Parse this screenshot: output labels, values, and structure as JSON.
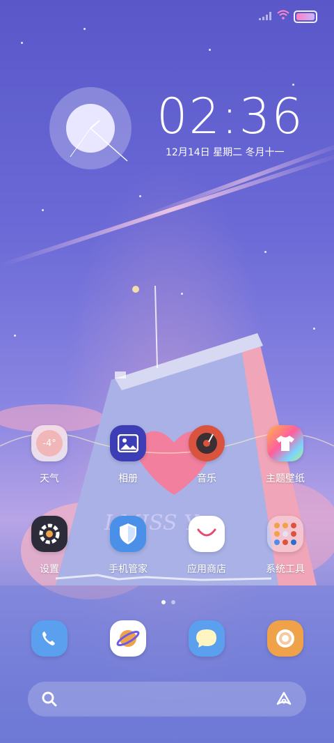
{
  "status_bar": {
    "signal_icon": "signal-icon",
    "wifi_icon": "wifi-icon",
    "battery_icon": "battery-icon"
  },
  "clock": {
    "time": "02:36",
    "date": "12月14日 星期二 冬月十一"
  },
  "wallpaper": {
    "illustration_text": "I MISS Y"
  },
  "apps": [
    {
      "label": "天气",
      "icon": "weather-icon",
      "value": "-4°"
    },
    {
      "label": "相册",
      "icon": "gallery-icon"
    },
    {
      "label": "音乐",
      "icon": "music-icon"
    },
    {
      "label": "主题壁纸",
      "icon": "theme-icon"
    },
    {
      "label": "设置",
      "icon": "settings-icon"
    },
    {
      "label": "手机管家",
      "icon": "shield-icon"
    },
    {
      "label": "应用商店",
      "icon": "app-store-icon"
    },
    {
      "label": "系统工具",
      "icon": "folder-icon"
    }
  ],
  "page_indicator": {
    "pages": 2,
    "active": 0
  },
  "dock": [
    {
      "icon": "phone-icon"
    },
    {
      "icon": "browser-icon"
    },
    {
      "icon": "messages-icon"
    },
    {
      "icon": "camera-icon"
    }
  ],
  "search_bar": {
    "search_icon": "search-icon",
    "assistant_icon": "assistant-icon"
  },
  "colors": {
    "sky": "#6a69d6",
    "gallery": "#3d3db5",
    "music": "#d9533e",
    "settings": "#2b2b3a",
    "shield": "#4a90e8",
    "camera": "#f0a24a"
  }
}
